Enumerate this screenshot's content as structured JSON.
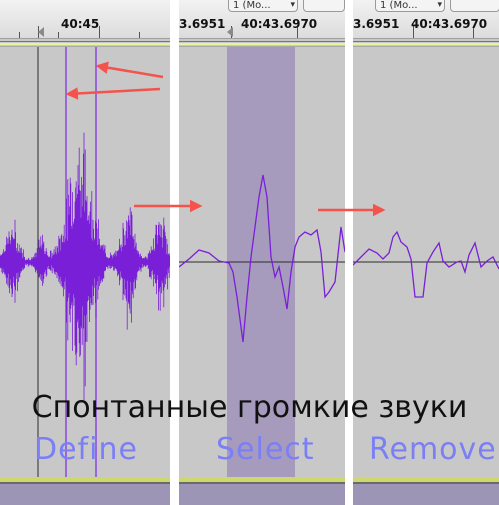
{
  "panels": [
    {
      "id": "define",
      "ruler_time": "40:45",
      "step_label": "Define"
    },
    {
      "id": "select",
      "ruler_time_left": "3.6951",
      "ruler_time_right": "40:43.6970",
      "track_menu": "1 (Mo...",
      "step_label": "Select"
    },
    {
      "id": "remove",
      "ruler_time_left": "3.6951",
      "ruler_time_right": "40:43.6970",
      "track_menu": "1 (Mo...",
      "step_label": "Remove"
    }
  ],
  "caption": "Спонтанные громкие звуки",
  "colors": {
    "waveform": "#7a1fd8",
    "selection": "#a79bbd",
    "arrow": "#f4524a",
    "step_label": "#7b7ff6",
    "ruler_highlight": "#e8f39a"
  },
  "icons": {
    "play_marker": "triangle-marker-icon",
    "dropdown": "chevron-down-icon",
    "arrow": "right-arrow-icon"
  }
}
